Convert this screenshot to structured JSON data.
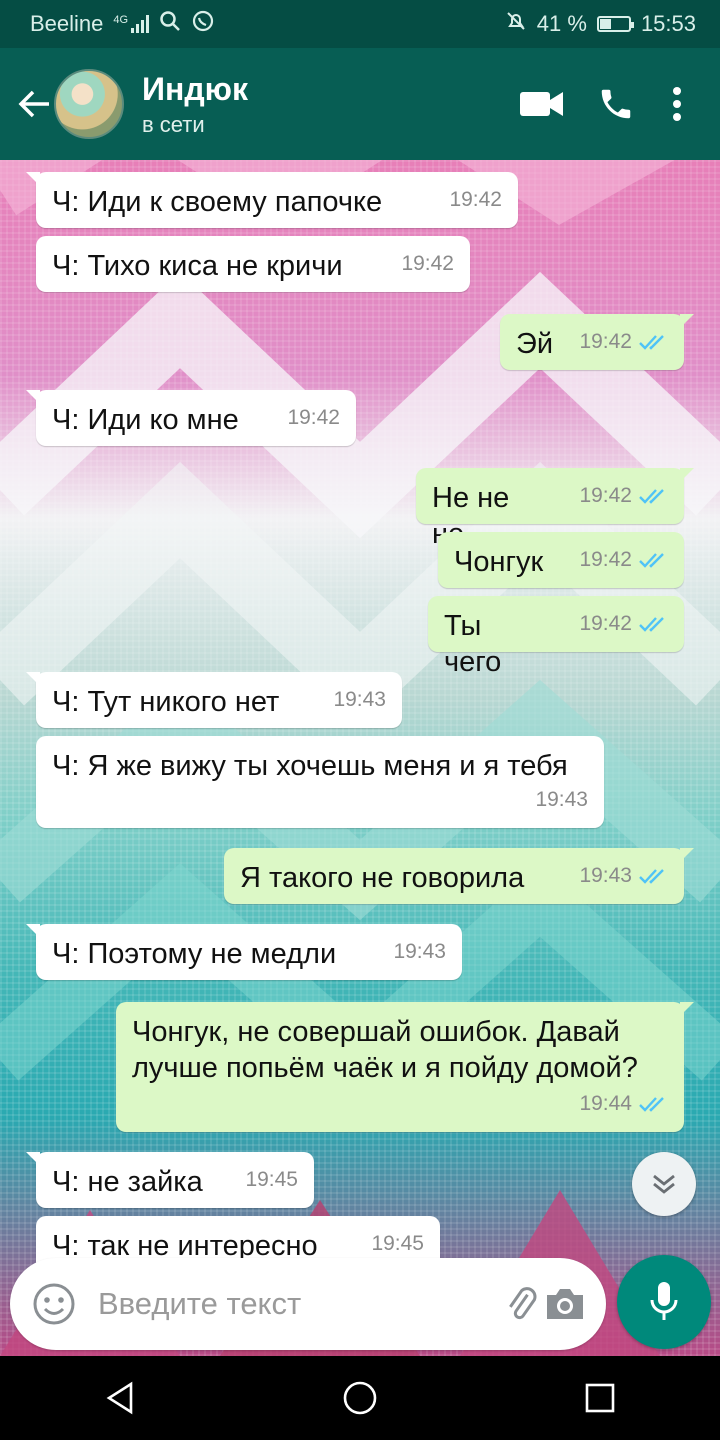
{
  "status_bar": {
    "carrier": "Beeline",
    "network": "4G",
    "battery_percent": "41 %",
    "battery_level": 0.41,
    "time": "15:53",
    "icons": [
      "signal-icon",
      "search-icon",
      "whatsapp-icon",
      "mute-icon",
      "battery-icon"
    ]
  },
  "header": {
    "contact_name": "Индюк",
    "contact_status": "в сети",
    "icons": [
      "back-arrow-icon",
      "avatar",
      "video-call-icon",
      "phone-call-icon",
      "more-vert-icon"
    ]
  },
  "messages": [
    {
      "dir": "in",
      "text": "Ч: Иди к своему папочке",
      "time": "19:42"
    },
    {
      "dir": "in",
      "text": "Ч: Тихо киса не кричи",
      "time": "19:42"
    },
    {
      "dir": "out",
      "text": "Эй",
      "time": "19:42"
    },
    {
      "dir": "in",
      "text": "Ч: Иди ко мне",
      "time": "19:42"
    },
    {
      "dir": "out",
      "text": "Не не не",
      "time": "19:42"
    },
    {
      "dir": "out",
      "text": "Чонгук",
      "time": "19:42"
    },
    {
      "dir": "out",
      "text": "Ты чего",
      "time": "19:42"
    },
    {
      "dir": "in",
      "text": "Ч: Тут никого нет",
      "time": "19:43"
    },
    {
      "dir": "in",
      "text": "Ч: Я же вижу ты хочешь меня и я тебя",
      "time": "19:43"
    },
    {
      "dir": "out",
      "text": "Я такого не говорила",
      "time": "19:43"
    },
    {
      "dir": "in",
      "text": "Ч: Поэтому не медли",
      "time": "19:43"
    },
    {
      "dir": "out",
      "text": "Чонгук, не совершай ошибок. Давай лучше попьём чаёк и я пойду домой?",
      "time": "19:44"
    },
    {
      "dir": "in",
      "text": "Ч: не зайка",
      "time": "19:45"
    },
    {
      "dir": "in",
      "text": "Ч: так не интересно",
      "time": "19:45"
    }
  ],
  "input": {
    "placeholder": "Введите текст",
    "icons": [
      "emoji-icon",
      "attach-icon",
      "camera-icon",
      "mic-icon",
      "scroll-down-icon"
    ]
  },
  "navbar": {
    "icons": [
      "back-triangle-icon",
      "home-circle-icon",
      "recents-square-icon"
    ]
  },
  "colors": {
    "header": "#075e54",
    "status_bar": "#054d44",
    "outgoing_bubble": "#dcf8c6",
    "incoming_bubble": "#ffffff",
    "read_ticks": "#4fc3f7",
    "mic_button": "#00897b"
  }
}
